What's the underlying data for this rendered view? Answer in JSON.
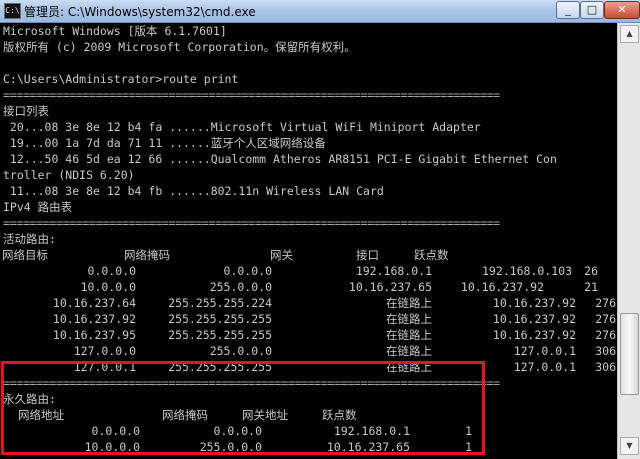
{
  "window": {
    "title": "管理员: C:\\Windows\\system32\\cmd.exe",
    "icon": "cmd-icon",
    "controls": {
      "minimize": "_",
      "maximize": "□",
      "close": "✕"
    }
  },
  "console": {
    "header_line1": "Microsoft Windows [版本 6.1.7601]",
    "header_line2": "版权所有 (c) 2009 Microsoft Corporation。保留所有权利。",
    "prompt": "C:\\Users\\Administrator>route print",
    "separator": "===========================================================================",
    "interface_title": "接口列表",
    "interfaces": [
      " 20...08 3e 8e 12 b4 fa ......Microsoft Virtual WiFi Miniport Adapter",
      " 19...00 1a 7d da 71 11 ......蓝牙个人区域网络设备",
      " 12...50 46 5d ea 12 66 ......Qualcomm Atheros AR8151 PCI-E Gigabit Ethernet Con",
      "troller (NDIS 6.20)",
      " 11...08 3e 8e 12 b4 fb ......802.11n Wireless LAN Card"
    ],
    "ipv4_title": "IPv4 路由表",
    "active_title": "活动路由:",
    "active_headers": {
      "dest": "网络目标",
      "mask": "网络掩码",
      "gateway": "网关",
      "iface": "接口",
      "metric": "跃点数"
    },
    "active_routes": [
      {
        "dest": "0.0.0.0",
        "mask": "0.0.0.0",
        "gateway": "192.168.0.1",
        "iface": "192.168.0.103",
        "metric": "26"
      },
      {
        "dest": "10.0.0.0",
        "mask": "255.0.0.0",
        "gateway": "10.16.237.65",
        "iface": "10.16.237.92",
        "metric": "21"
      },
      {
        "dest": "10.16.237.64",
        "mask": "255.255.255.224",
        "gateway": "在链路上",
        "iface": "10.16.237.92",
        "metric": "276"
      },
      {
        "dest": "10.16.237.92",
        "mask": "255.255.255.255",
        "gateway": "在链路上",
        "iface": "10.16.237.92",
        "metric": "276"
      },
      {
        "dest": "10.16.237.95",
        "mask": "255.255.255.255",
        "gateway": "在链路上",
        "iface": "10.16.237.92",
        "metric": "276"
      },
      {
        "dest": "127.0.0.0",
        "mask": "255.0.0.0",
        "gateway": "在链路上",
        "iface": "127.0.0.1",
        "metric": "306"
      },
      {
        "dest": "127.0.0.1",
        "mask": "255.255.255.255",
        "gateway": "在链路上",
        "iface": "127.0.0.1",
        "metric": "306"
      }
    ],
    "persistent_title": "永久路由:",
    "persistent_headers": {
      "address": "网络地址",
      "mask": "网络掩码",
      "gateway": "网关地址",
      "metric": "跃点数"
    },
    "persistent_routes": [
      {
        "address": "0.0.0.0",
        "mask": "0.0.0.0",
        "gateway": "192.168.0.1",
        "metric": "1"
      },
      {
        "address": "10.0.0.0",
        "mask": "255.0.0.0",
        "gateway": "10.16.237.65",
        "metric": "1"
      }
    ]
  },
  "colors": {
    "console_bg": "#000000",
    "console_text": "#c9c9c9",
    "highlight_box": "#e8141c"
  }
}
